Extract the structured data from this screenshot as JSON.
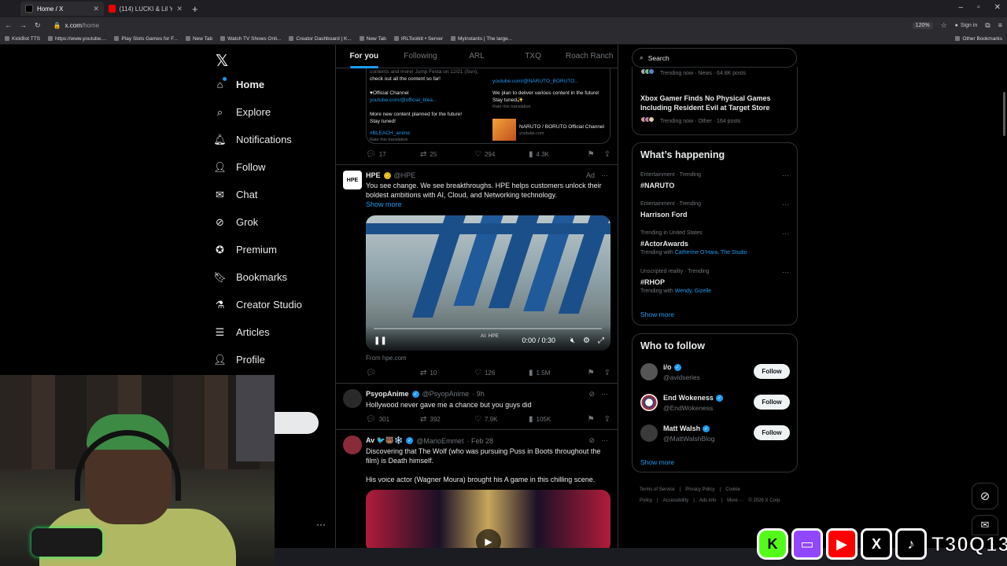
{
  "browser": {
    "tabs": [
      {
        "label": "Home / X",
        "active": true
      },
      {
        "label": "(114) LUCKI & Lil Yachty - I Dor",
        "active": false
      }
    ],
    "url_host": "x.com",
    "url_path": "/home",
    "zoom": "120%",
    "signin": "Sign in",
    "bookmarks": [
      "KickBot TTS",
      "https://www.youtube....",
      "Play Slots Games for F...",
      "New Tab",
      "Watch TV Shows Onli...",
      "Creator Dashboard | K...",
      "New Tab",
      "IRLToolkit • Server",
      "Myinstants | The large..."
    ],
    "other_bookmarks": "Other Bookmarks"
  },
  "nav": {
    "items": [
      {
        "label": "Home",
        "icon": "home-icon"
      },
      {
        "label": "Explore",
        "icon": "search-icon"
      },
      {
        "label": "Notifications",
        "icon": "bell-icon"
      },
      {
        "label": "Follow",
        "icon": "person-plus-icon"
      },
      {
        "label": "Chat",
        "icon": "mail-icon"
      },
      {
        "label": "Grok",
        "icon": "grok-icon"
      },
      {
        "label": "Premium",
        "icon": "premium-icon"
      },
      {
        "label": "Bookmarks",
        "icon": "bookmark-icon"
      },
      {
        "label": "Creator Studio",
        "icon": "flask-icon"
      },
      {
        "label": "Articles",
        "icon": "article-icon"
      },
      {
        "label": "Profile",
        "icon": "person-icon"
      }
    ]
  },
  "feed": {
    "tabs": [
      "For you",
      "Following",
      "ARL",
      "TXQ",
      "Roach Ranch"
    ],
    "quote": {
      "left_lines": [
        "♥Official Channel",
        "youtube.com/@official_blea...",
        "More new content planned for the future!",
        "Stay tuned!",
        "#BLEACH_anime",
        "Rate this translation"
      ],
      "left_top": [
        "contents and more! Jump Festa on 12/21 (Sun),",
        "check out all the content so far!"
      ],
      "right_lines": [
        "youtube.com/@NARUTO_BORUTO...",
        "We plan to deliver various content in the future!",
        "Stay tuned✨",
        "Rate this translation"
      ],
      "card_title": "NARUTO / BORUTO Official Channel",
      "card_site": "youtube.com"
    },
    "first_actions": {
      "replies": "17",
      "reposts": "25",
      "likes": "294",
      "views": "4.3K"
    },
    "ad_post": {
      "name": "HPE",
      "handle": "@HPE",
      "ad_label": "Ad",
      "text": "You see change. We see breakthroughs. HPE helps customers unlock their boldest ambitions with AI, Cloud, and Networking technology.",
      "show_more": "Show more",
      "video_time": "0:00 / 0:30",
      "video_watermark": "AI: HPE",
      "from": "From hpe.com",
      "reposts": "10",
      "likes": "126",
      "views": "1.5M"
    },
    "post2": {
      "name": "PsyopAnime",
      "handle": "@PsyopAnime",
      "time": "· 9h",
      "text": "Hollywood never gave me a chance but you guys did",
      "replies": "301",
      "reposts": "392",
      "likes": "7.9K",
      "views": "105K"
    },
    "post3": {
      "name": "Av 🐦🐻❄️",
      "handle": "@MarioEmmet",
      "time": "· Feb 28",
      "text1": "Discovering that The Wolf (who was pursuing Puss in Boots throughout the film) is Death himself.",
      "text2": "His voice actor (Wagner Moura) brought his A game in this chilling scene."
    }
  },
  "right": {
    "search_placeholder": "Search",
    "top_trend_meta": "Trending now · News · 64.8K posts",
    "top_story_title": "Xbox Gamer Finds No Physical Games Including Resident Evil at Target Store",
    "top_story_meta": "Trending now · Other · 164 posts",
    "whats_happening": "What’s happening",
    "trends": [
      {
        "meta": "Entertainment · Trending",
        "title": "#NARUTO",
        "with": ""
      },
      {
        "meta": "Entertainment · Trending",
        "title": "Harrison Ford",
        "with": ""
      },
      {
        "meta": "Trending in United States",
        "title": "#ActorAwards",
        "with_label": "Trending with",
        "with": "Catherine O’Hara, The Studio"
      },
      {
        "meta": "Unscripted reality · Trending",
        "title": "#RHOP",
        "with_label": "Trending with",
        "with": "Wendy, Gizelle"
      }
    ],
    "show_more": "Show more",
    "who_to_follow": "Who to follow",
    "follow_label": "Follow",
    "accounts": [
      {
        "name": "i/o",
        "handle": "@avidseries"
      },
      {
        "name": "End Wokeness",
        "handle": "@EndWokeness"
      },
      {
        "name": "Matt Walsh",
        "handle": "@MattWalshBlog"
      }
    ],
    "footer": [
      "Terms of Service",
      "|",
      "Privacy Policy",
      "|",
      "Cookie Policy",
      "|",
      "Accessibility",
      "|",
      "Ads info",
      "|",
      "More ···",
      "© 2026 X Corp."
    ]
  },
  "overlay": {
    "brand": "T30Q13"
  }
}
